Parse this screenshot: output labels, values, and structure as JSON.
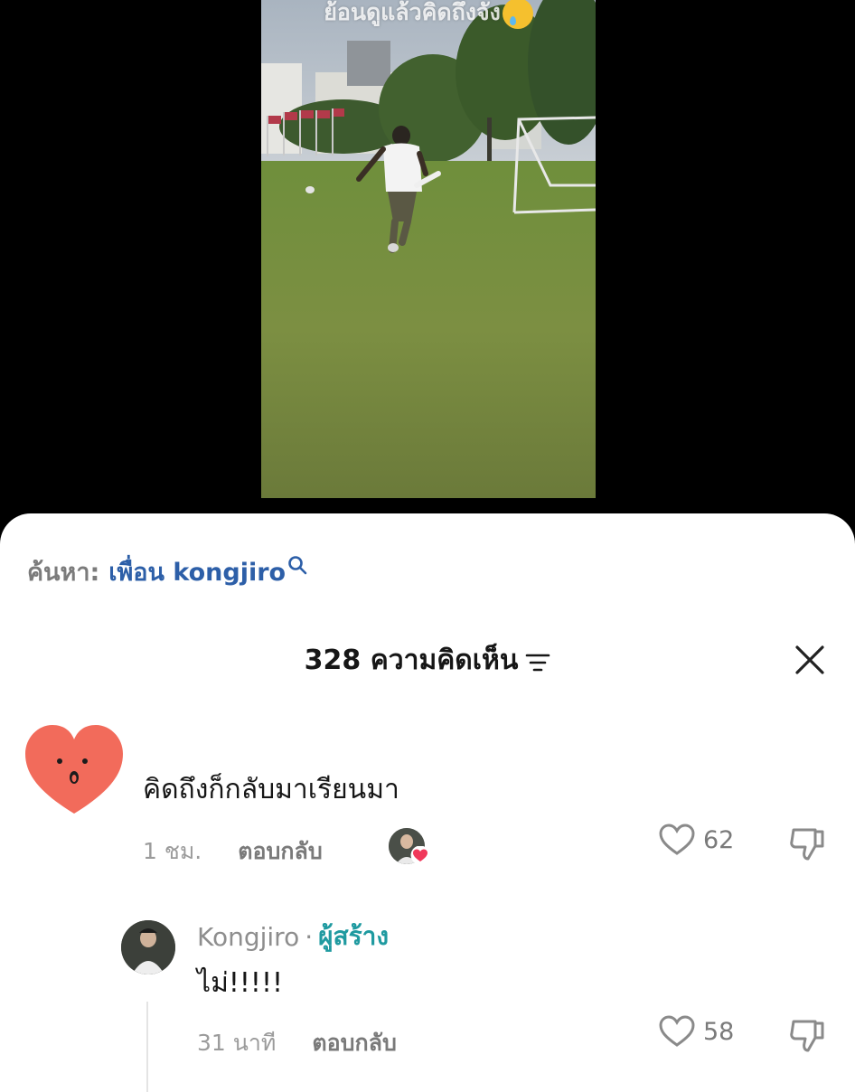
{
  "video": {
    "caption": "ย้อนดูแล้วคิดถึงจัง",
    "caption_emoji": "face-holding-back-tears"
  },
  "search": {
    "prefix": "ค้นหา:",
    "query": "เพื่อน kongjiro"
  },
  "comments_header": {
    "title": "328 ความคิดเห็น"
  },
  "comments": [
    {
      "avatar": "red-heart-face",
      "text": "คิดถึงก็กลับมาเรียนมา",
      "time": "1 ชม.",
      "reply_label": "ตอบกลับ",
      "liked_by_creator": true,
      "likes": "62"
    }
  ],
  "reply": {
    "author": "Kongjiro",
    "separator": "·",
    "badge": "ผู้สร้าง",
    "text": "ไม่!!!!!",
    "time": "31 นาที",
    "reply_label": "ตอบกลับ",
    "likes": "58"
  },
  "colors": {
    "accent_blue": "#2d5fa8",
    "creator_teal": "#1f9aa0",
    "like_heart": "#f0385a"
  }
}
